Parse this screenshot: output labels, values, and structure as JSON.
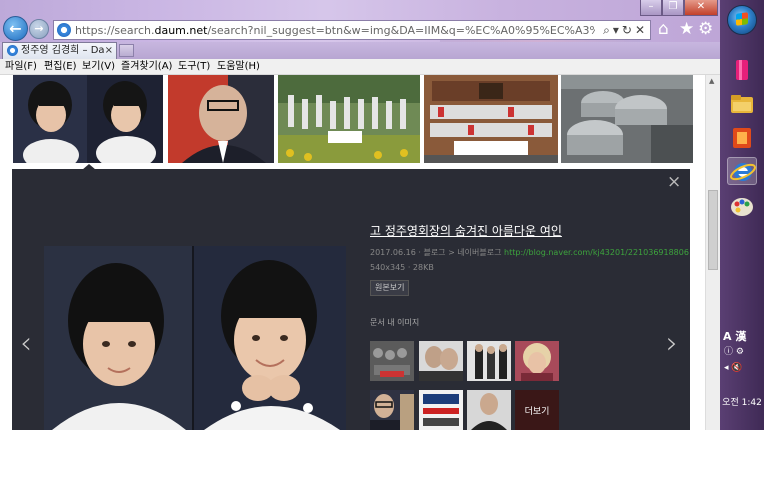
{
  "browser": {
    "url_prefix": "https://search.",
    "url_domain": "daum.net",
    "url_rest": "/search?nil_suggest=btn&w=img&DA=IIM&q=%EC%A0%95%EC%A3%BC%EC%98%81+%EA%B9%80%",
    "tab_title": "정주영 김경희 – Da...",
    "tab_close": "×",
    "menu": [
      "파일(F)",
      "편집(E)",
      "보기(V)",
      "즐겨찾기(A)",
      "도구(T)",
      "도움말(H)"
    ]
  },
  "viewer": {
    "title": "고 정주영회장의 숨겨진 아름다운 여인",
    "date": "2017.06.16",
    "source_path": "블로그 > 네이버블로그",
    "source_url": "http://blog.naver.com/kj43201/221036918806",
    "dimensions": "540x345 · 28KB",
    "original_button": "원본보기",
    "related_label": "문서 내 이미지",
    "more_label": "더보기",
    "close_glyph": "×",
    "prev_glyph": "‹",
    "next_glyph": "›"
  },
  "taskbar": {
    "ime_label": "A 漢",
    "clock": "오전 1:42"
  },
  "icons": {
    "back": "back-arrow-icon",
    "forward": "forward-arrow-icon",
    "home": "home-icon",
    "favorites": "star-icon",
    "tools": "gear-icon"
  },
  "colors": {
    "viewer_bg": "#2a2c35",
    "title_bar": "#c8b4e0",
    "source_green": "#3da33d",
    "taskbar": "#4a3462"
  }
}
